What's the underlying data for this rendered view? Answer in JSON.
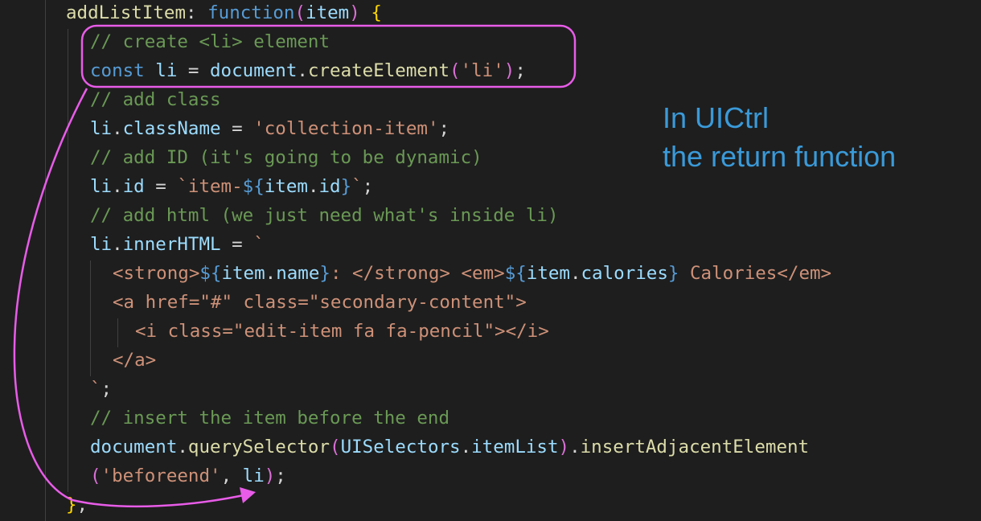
{
  "colors": {
    "background": "#1e1e1e",
    "keyword": "#569cd6",
    "variable": "#9cdcfe",
    "function": "#dcdcaa",
    "string": "#ce9178",
    "comment": "#6a9955",
    "punctuation": "#d4d4d4",
    "bracket_gold": "#ffd700",
    "bracket_pink": "#da70d6",
    "annotation": "#3a9ad9",
    "highlight": "#e85ce8"
  },
  "code_lines": [
    [
      [
        "addListItem",
        "function"
      ],
      [
        ": ",
        "punctuation"
      ],
      [
        "function",
        "keyword"
      ],
      [
        "(",
        "bracket_pink"
      ],
      [
        "item",
        "variable"
      ],
      [
        ") ",
        "bracket_pink"
      ],
      [
        "{",
        "bracket_gold"
      ]
    ],
    [
      [
        "// create <li> element",
        "comment"
      ]
    ],
    [
      [
        "const ",
        "keyword"
      ],
      [
        "li",
        "variable"
      ],
      [
        " = ",
        "punctuation"
      ],
      [
        "document",
        "variable"
      ],
      [
        ".",
        "punctuation"
      ],
      [
        "createElement",
        "function"
      ],
      [
        "(",
        "bracket_pink"
      ],
      [
        "'li'",
        "string"
      ],
      [
        ")",
        "bracket_pink"
      ],
      [
        ";",
        "punctuation"
      ]
    ],
    [
      [
        "// add class",
        "comment"
      ]
    ],
    [
      [
        "li",
        "variable"
      ],
      [
        ".",
        "punctuation"
      ],
      [
        "className",
        "variable"
      ],
      [
        " = ",
        "punctuation"
      ],
      [
        "'collection-item'",
        "string"
      ],
      [
        ";",
        "punctuation"
      ]
    ],
    [
      [
        "// add ID (it's going to be dynamic)",
        "comment"
      ]
    ],
    [
      [
        "li",
        "variable"
      ],
      [
        ".",
        "punctuation"
      ],
      [
        "id",
        "variable"
      ],
      [
        " = ",
        "punctuation"
      ],
      [
        "`item-",
        "string"
      ],
      [
        "${",
        "keyword"
      ],
      [
        "item",
        "variable"
      ],
      [
        ".",
        "punctuation"
      ],
      [
        "id",
        "variable"
      ],
      [
        "}",
        "keyword"
      ],
      [
        "`",
        "string"
      ],
      [
        ";",
        "punctuation"
      ]
    ],
    [
      [
        "// add html (we just need what's inside li)",
        "comment"
      ]
    ],
    [
      [
        "li",
        "variable"
      ],
      [
        ".",
        "punctuation"
      ],
      [
        "innerHTML",
        "variable"
      ],
      [
        " = ",
        "punctuation"
      ],
      [
        "`",
        "string"
      ]
    ],
    [
      [
        "<strong>",
        "string"
      ],
      [
        "${",
        "keyword"
      ],
      [
        "item",
        "variable"
      ],
      [
        ".",
        "punctuation"
      ],
      [
        "name",
        "variable"
      ],
      [
        "}",
        "keyword"
      ],
      [
        ": </strong> <em>",
        "string"
      ],
      [
        "${",
        "keyword"
      ],
      [
        "item",
        "variable"
      ],
      [
        ".",
        "punctuation"
      ],
      [
        "calories",
        "variable"
      ],
      [
        "}",
        "keyword"
      ],
      [
        " Calories</em>",
        "string"
      ]
    ],
    [
      [
        "<a href=\"#\" class=\"secondary-content\">",
        "string"
      ]
    ],
    [
      [
        "<i class=\"edit-item fa fa-pencil\"></i>",
        "string"
      ]
    ],
    [
      [
        "</a>",
        "string"
      ]
    ],
    [
      [
        "`",
        "string"
      ],
      [
        ";",
        "punctuation"
      ]
    ],
    [
      [
        "// insert the item before the end",
        "comment"
      ]
    ],
    [
      [
        "document",
        "variable"
      ],
      [
        ".",
        "punctuation"
      ],
      [
        "querySelector",
        "function"
      ],
      [
        "(",
        "bracket_pink"
      ],
      [
        "UISelectors",
        "variable"
      ],
      [
        ".",
        "punctuation"
      ],
      [
        "itemList",
        "variable"
      ],
      [
        ")",
        "bracket_pink"
      ],
      [
        ".",
        "punctuation"
      ],
      [
        "insertAdjacentElement",
        "function"
      ]
    ],
    [
      [
        "(",
        "bracket_pink"
      ],
      [
        "'beforeend'",
        "string"
      ],
      [
        ", ",
        "punctuation"
      ],
      [
        "li",
        "variable"
      ],
      [
        ")",
        "bracket_pink"
      ],
      [
        ";",
        "punctuation"
      ]
    ],
    [
      [
        "}",
        "bracket_gold"
      ],
      [
        ",",
        "punctuation"
      ]
    ]
  ],
  "annotation": {
    "line1": "In UICtrl",
    "line2": "the return function"
  }
}
